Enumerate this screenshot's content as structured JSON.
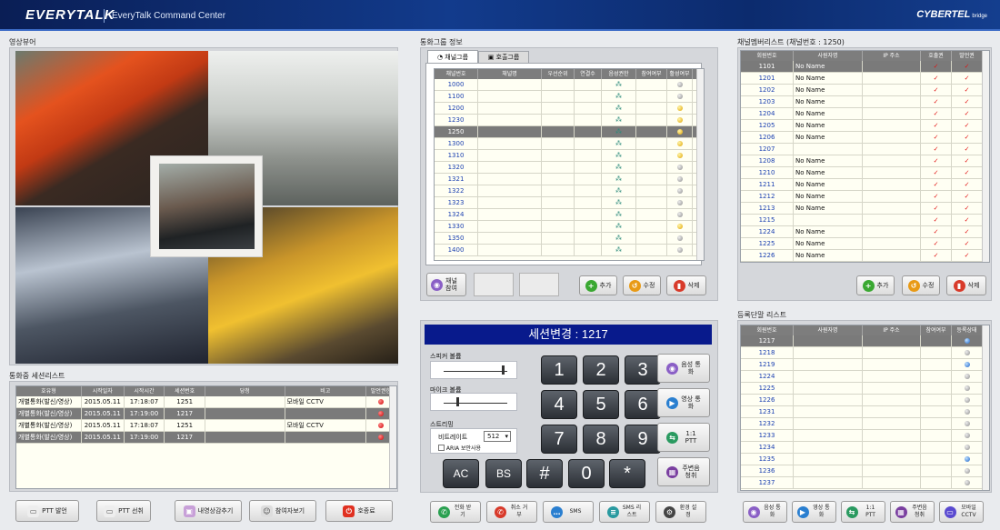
{
  "app": {
    "logo": "EVERYTALK",
    "title": "EveryTalk Command Center",
    "brand": "CYBERTEL",
    "brand_sub": "bridge"
  },
  "video": {
    "title": "영상뷰어"
  },
  "sessions": {
    "title": "통화중 세션리스트",
    "cols": [
      "호유형",
      "시작일자",
      "시작시간",
      "세션번호",
      "당청",
      "비고",
      "발언권한"
    ],
    "rows": [
      {
        "c": [
          "개별통화(발신/영상)",
          "2015.05.11",
          "17:18:07",
          "1251",
          "",
          "모바일 CCTV"
        ],
        "sel": false
      },
      {
        "c": [
          "개별통화(발신/영상)",
          "2015.05.11",
          "17:19:00",
          "1217",
          "",
          ""
        ],
        "sel": true
      },
      {
        "c": [
          "개별통화(발신/영상)",
          "2015.05.11",
          "17:18:07",
          "1251",
          "",
          "모바일 CCTV"
        ],
        "sel": false
      },
      {
        "c": [
          "개별통화(발신/영상)",
          "2015.05.11",
          "17:19:00",
          "1217",
          "",
          ""
        ],
        "sel": true
      }
    ]
  },
  "left_buttons": [
    "PTT 발언",
    "PTT 선취",
    "내영상감추기",
    "참여자보기",
    "호종료"
  ],
  "group": {
    "title": "통화그룹 정보",
    "tab1": "채널그룹",
    "tab2": "호출그룹",
    "cols": [
      "채널번호",
      "채널명",
      "우선순위",
      "연결수",
      "음성권한",
      "참여여부",
      "활성여부"
    ],
    "rows": [
      {
        "n": "1000",
        "d": "grey"
      },
      {
        "n": "1100",
        "d": "grey"
      },
      {
        "n": "1200",
        "d": "gold"
      },
      {
        "n": "1230",
        "d": "gold"
      },
      {
        "n": "1250",
        "d": "gold",
        "sel": true
      },
      {
        "n": "1300",
        "d": "gold"
      },
      {
        "n": "1310",
        "d": "gold"
      },
      {
        "n": "1320",
        "d": "grey"
      },
      {
        "n": "1321",
        "d": "grey"
      },
      {
        "n": "1322",
        "d": "grey"
      },
      {
        "n": "1323",
        "d": "grey"
      },
      {
        "n": "1324",
        "d": "grey"
      },
      {
        "n": "1330",
        "d": "gold"
      },
      {
        "n": "1350",
        "d": "grey"
      },
      {
        "n": "1400",
        "d": "grey"
      }
    ],
    "channel_join": "채널 참여",
    "add": "추가",
    "edit": "수정",
    "del": "삭제"
  },
  "members": {
    "title": "채널멤버리스트 (채널번호 : 1250)",
    "cols": [
      "회원번호",
      "사원자명",
      "IP 주소",
      "호출권",
      "발언권"
    ],
    "rows": [
      {
        "n": "1101",
        "nm": "No Name",
        "sel": true
      },
      {
        "n": "1201",
        "nm": "No Name"
      },
      {
        "n": "1202",
        "nm": "No Name"
      },
      {
        "n": "1203",
        "nm": "No Name"
      },
      {
        "n": "1204",
        "nm": "No Name"
      },
      {
        "n": "1205",
        "nm": "No Name"
      },
      {
        "n": "1206",
        "nm": "No Name"
      },
      {
        "n": "1207",
        "nm": ""
      },
      {
        "n": "1208",
        "nm": "No Name"
      },
      {
        "n": "1210",
        "nm": "No Name"
      },
      {
        "n": "1211",
        "nm": "No Name"
      },
      {
        "n": "1212",
        "nm": "No Name"
      },
      {
        "n": "1213",
        "nm": "No Name"
      },
      {
        "n": "1215",
        "nm": ""
      },
      {
        "n": "1224",
        "nm": "No Name"
      },
      {
        "n": "1225",
        "nm": "No Name"
      },
      {
        "n": "1226",
        "nm": "No Name"
      }
    ],
    "add": "추가",
    "edit": "수정",
    "del": "삭제"
  },
  "terminals": {
    "title": "등록단말 리스트",
    "cols": [
      "회원번호",
      "사원자명",
      "IP 주소",
      "참여여부",
      "등록상태"
    ],
    "rows": [
      {
        "n": "1217",
        "sel": true,
        "d": "blue"
      },
      {
        "n": "1218",
        "d": "grey"
      },
      {
        "n": "1219",
        "d": "blue"
      },
      {
        "n": "1224",
        "d": "grey"
      },
      {
        "n": "1225",
        "d": "grey"
      },
      {
        "n": "1226",
        "d": "grey"
      },
      {
        "n": "1231",
        "d": "grey"
      },
      {
        "n": "1232",
        "d": "grey"
      },
      {
        "n": "1233",
        "d": "grey"
      },
      {
        "n": "1234",
        "d": "grey"
      },
      {
        "n": "1235",
        "d": "blue"
      },
      {
        "n": "1236",
        "d": "grey"
      },
      {
        "n": "1237",
        "d": "grey"
      }
    ]
  },
  "dial": {
    "session": "세션변경 : 1217",
    "speaker": "스피커 볼륨",
    "mic": "마이크 볼륨",
    "streaming": "스트리밍",
    "bitrate_label": "비트레이트",
    "bitrate": "512",
    "aria": "ARIA 보안사용",
    "keys": [
      "1",
      "2",
      "3",
      "4",
      "5",
      "6",
      "7",
      "8",
      "9"
    ],
    "bottom": [
      "AC",
      "BS",
      "#",
      "0",
      "*"
    ],
    "side": [
      "음성 통화",
      "영상 통화",
      "1:1 PTT",
      "주변음 청취"
    ]
  },
  "mid_buttons": [
    "전화 받기",
    "취소 거부",
    "SMS",
    "SMS 리스트",
    "환경 설정"
  ],
  "right_buttons": [
    "음성 통화",
    "영상 통화",
    "1:1 PTT",
    "주변음 청취",
    "모바일 CCTV"
  ]
}
